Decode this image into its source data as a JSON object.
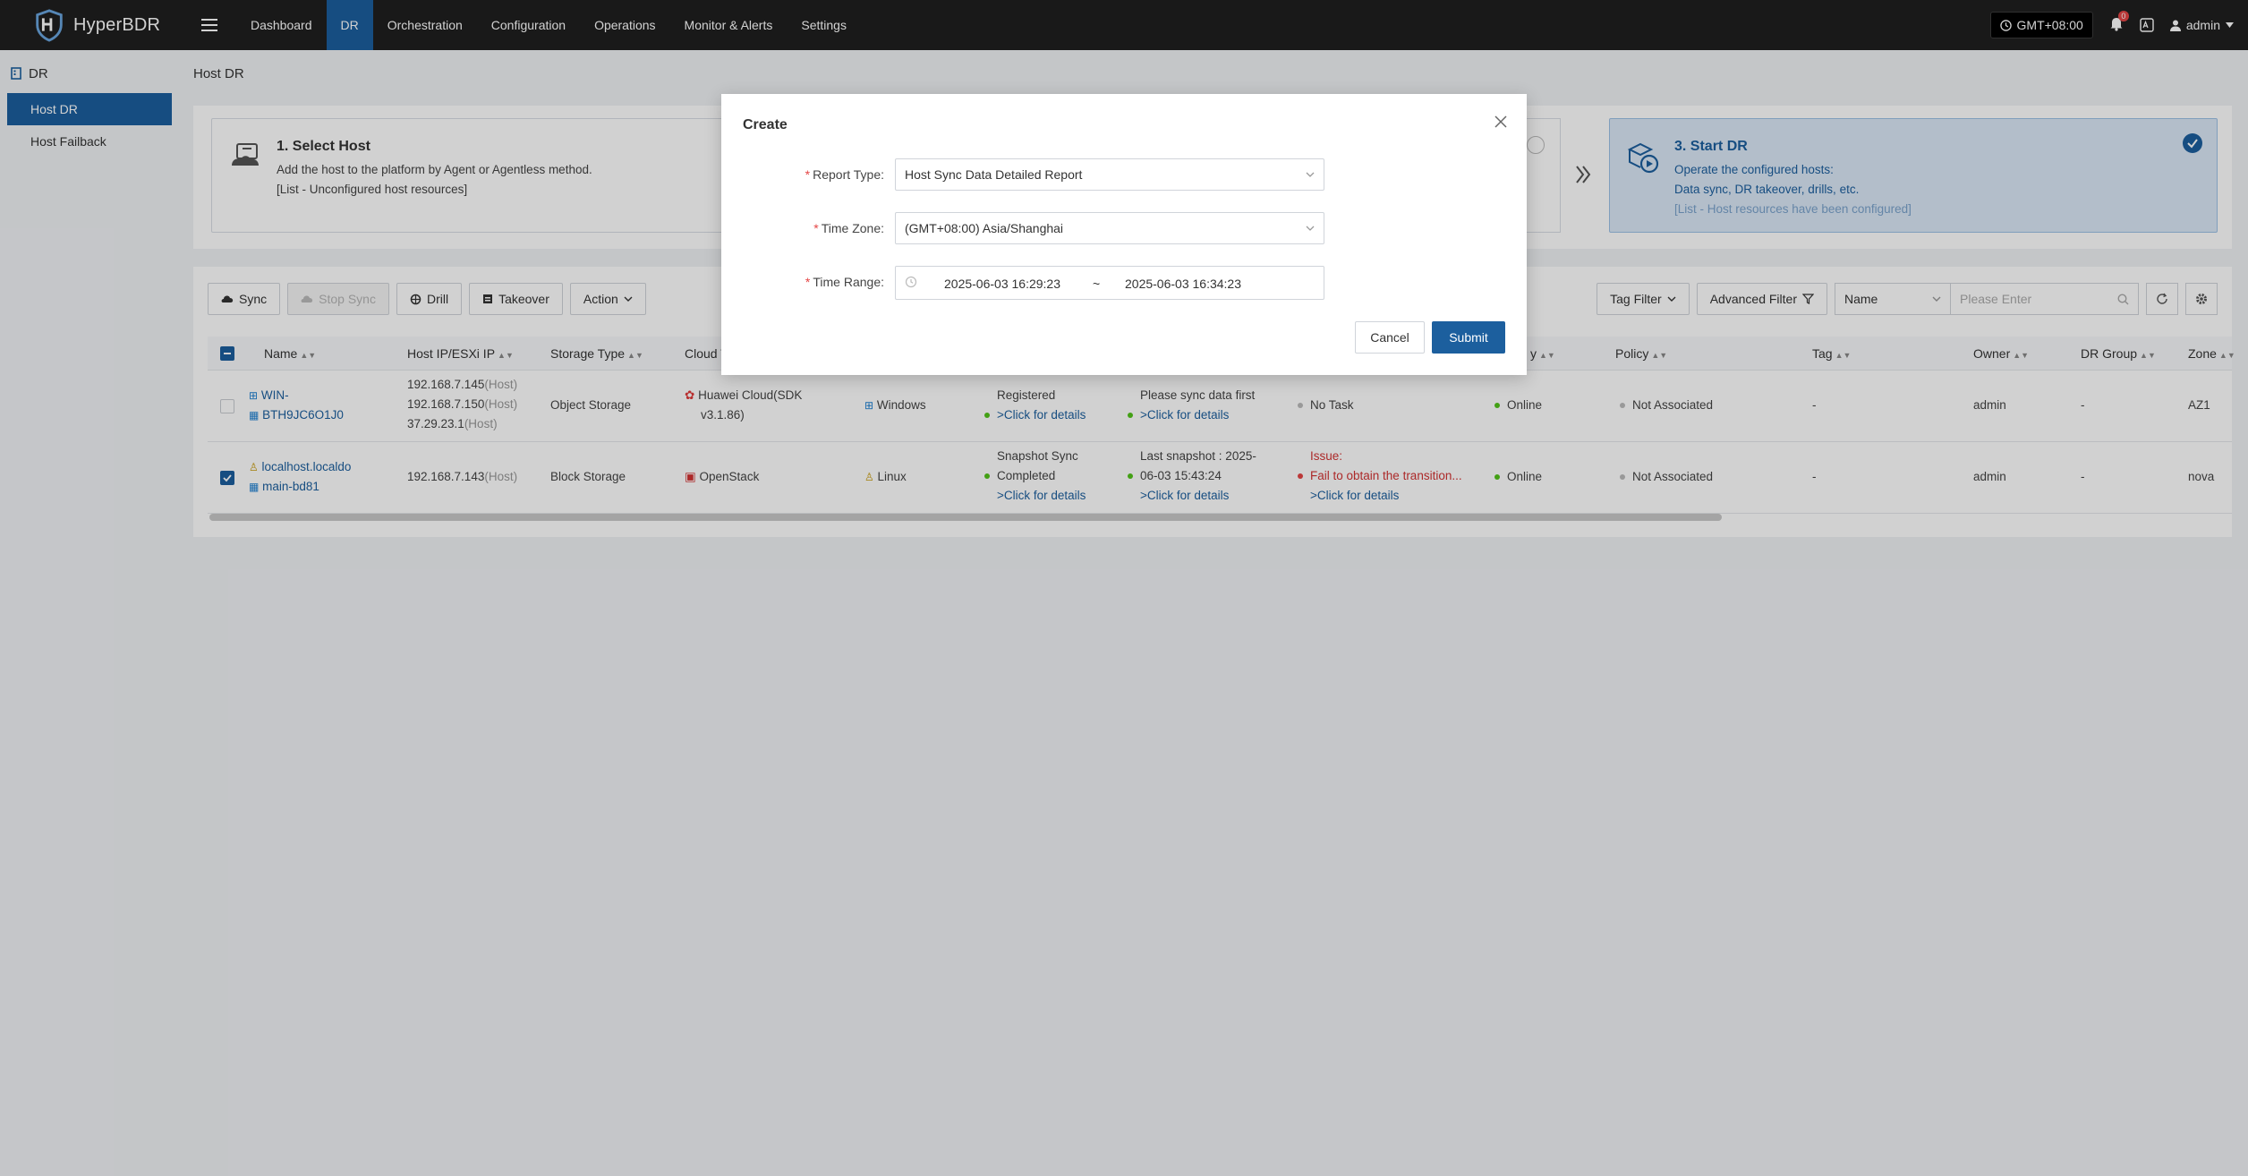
{
  "app": {
    "name": "HyperBDR"
  },
  "nav": {
    "items": [
      {
        "label": "Dashboard"
      },
      {
        "label": "DR"
      },
      {
        "label": "Orchestration"
      },
      {
        "label": "Configuration"
      },
      {
        "label": "Operations"
      },
      {
        "label": "Monitor & Alerts"
      },
      {
        "label": "Settings"
      }
    ],
    "active_index": 1
  },
  "topbar": {
    "timezone": "GMT+08:00",
    "notification_count": "0",
    "user": "admin"
  },
  "sidebar": {
    "section": "DR",
    "items": [
      {
        "label": "Host DR"
      },
      {
        "label": "Host Failback"
      }
    ]
  },
  "page": {
    "title": "Host DR"
  },
  "steps": {
    "step1": {
      "title": "1. Select Host",
      "line1": "Add the host to the platform by Agent or Agentless method.",
      "line2": "[List - Unconfigured host resources]"
    },
    "step3": {
      "title": "3. Start DR",
      "line1": "Operate the configured hosts:",
      "line2": "Data sync, DR takeover, drills, etc.",
      "line3": "[List - Host resources have been configured]"
    }
  },
  "toolbar": {
    "sync": "Sync",
    "stop_sync": "Stop Sync",
    "drill": "Drill",
    "takeover": "Takeover",
    "action": "Action",
    "tag_filter": "Tag Filter",
    "advanced_filter": "Advanced Filter",
    "search_field": "Name",
    "search_placeholder": "Please Enter"
  },
  "table": {
    "columns": {
      "name": "Name",
      "host_ip": "Host IP/ESXi IP",
      "storage_type": "Storage Type",
      "cloud_type": "Cloud Typ",
      "availability_tail": "y",
      "policy": "Policy",
      "tag": "Tag",
      "owner": "Owner",
      "dr_group": "DR Group",
      "zone": "Zone"
    },
    "rows": [
      {
        "name_line1": "WIN-",
        "name_line2": "BTH9JC6O1J0",
        "ips": [
          {
            "ip": "192.168.7.145",
            "kind": "(Host)"
          },
          {
            "ip": "192.168.7.150",
            "kind": "(Host)"
          },
          {
            "ip": "37.29.23.1",
            "kind": "(Host)"
          }
        ],
        "storage": "Object Storage",
        "cloud_line1": "Huawei Cloud(SDK",
        "cloud_line2": "v3.1.86)",
        "os": "Windows",
        "reg_line1": "Registered",
        "reg_link": ">Click for details",
        "sync_line1": "Please sync data first",
        "sync_link": ">Click for details",
        "task": "No Task",
        "status": "Online",
        "policy": "Not Associated",
        "tag": "-",
        "owner": "admin",
        "dr_group": "-",
        "zone": "AZ1"
      },
      {
        "name_line1": "localhost.localdo",
        "name_line2": "main-bd81",
        "ips": [
          {
            "ip": "192.168.7.143",
            "kind": "(Host)"
          }
        ],
        "storage": "Block Storage",
        "cloud_line1": "OpenStack",
        "os": "Linux",
        "reg_line1": "Snapshot Sync",
        "reg_line2": "Completed",
        "reg_link": ">Click for details",
        "sync_line1": "Last snapshot : 2025-",
        "sync_line2": "06-03 15:43:24",
        "sync_link": ">Click for details",
        "issue_label": "Issue:",
        "issue_text": "Fail to obtain the transition...",
        "issue_link": ">Click for details",
        "status": "Online",
        "policy": "Not Associated",
        "tag": "-",
        "owner": "admin",
        "dr_group": "-",
        "zone": "nova"
      }
    ]
  },
  "modal": {
    "title": "Create",
    "report_type_label": "Report Type:",
    "report_type_value": "Host Sync Data Detailed Report",
    "time_zone_label": "Time Zone:",
    "time_zone_value": "(GMT+08:00) Asia/Shanghai",
    "time_range_label": "Time Range:",
    "time_start": "2025-06-03 16:29:23",
    "time_sep": "~",
    "time_end": "2025-06-03 16:34:23",
    "cancel": "Cancel",
    "submit": "Submit"
  },
  "colors": {
    "primary": "#1c5f9e",
    "topbar": "#1f1f1f",
    "online": "#52c41a",
    "error": "#d23333"
  }
}
